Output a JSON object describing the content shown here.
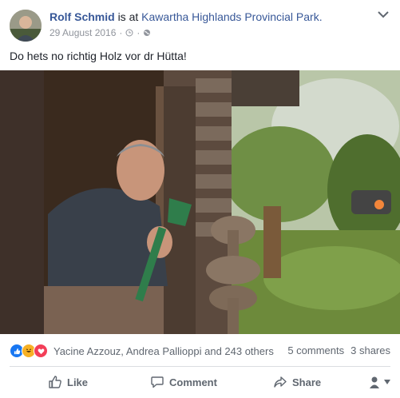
{
  "post": {
    "author": "Rolf Schmid",
    "is_at": "is at",
    "place": "Kawartha Highlands Provincial Park.",
    "date": "29 August 2016",
    "dot": "·",
    "text": "Do hets no richtig Holz vor dr Hütta!"
  },
  "reactions": {
    "names": "Yacine Azzouz, Andrea Pallioppi and 243 others",
    "comments": "5 comments",
    "shares": "3 shares",
    "icons": [
      "like-icon",
      "haha-icon",
      "love-icon"
    ]
  },
  "actions": {
    "like": "Like",
    "comment": "Comment",
    "share": "Share"
  },
  "colors": {
    "link": "#385898",
    "secondary": "#90949c",
    "like_blue": "#1877f2",
    "love_red": "#f33e58",
    "haha_yellow": "#f7b125"
  }
}
